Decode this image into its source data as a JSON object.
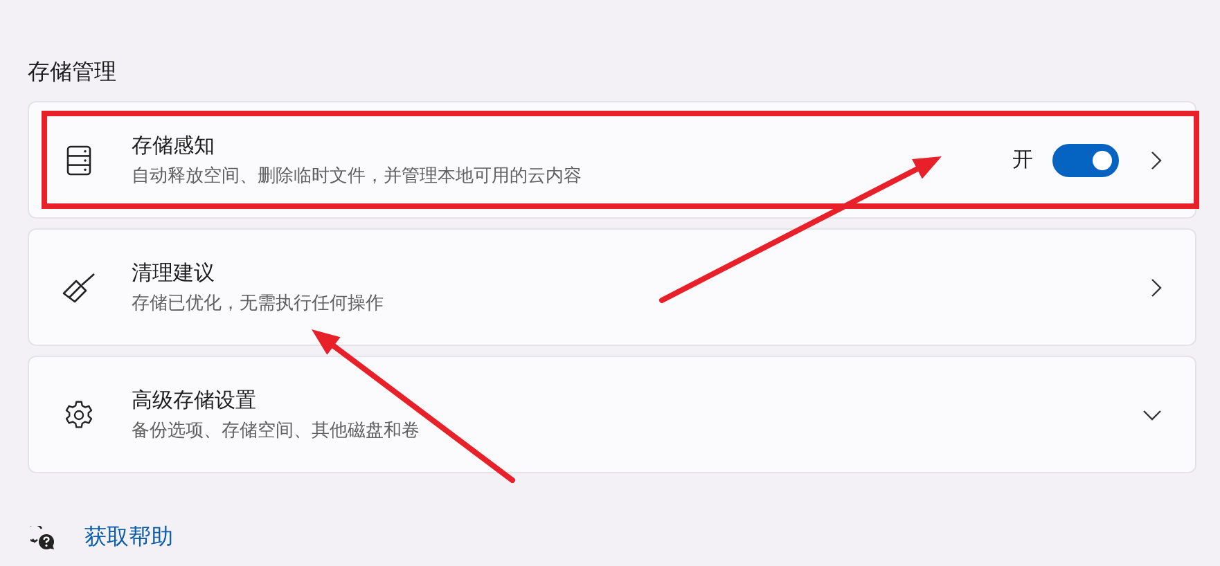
{
  "section_title": "存储管理",
  "cards": [
    {
      "title": "存储感知",
      "description": "自动释放空间、删除临时文件，并管理本地可用的云内容",
      "toggle": {
        "label": "开",
        "on": true
      },
      "kind": "navigate",
      "highlighted": true
    },
    {
      "title": "清理建议",
      "description": "存储已优化，无需执行任何操作",
      "kind": "navigate",
      "highlighted": false
    },
    {
      "title": "高级存储设置",
      "description": "备份选项、存储空间、其他磁盘和卷",
      "kind": "expand",
      "highlighted": false
    }
  ],
  "annotations": [
    {
      "kind": "arrow"
    },
    {
      "kind": "arrow"
    }
  ],
  "help_link": "获取帮助"
}
